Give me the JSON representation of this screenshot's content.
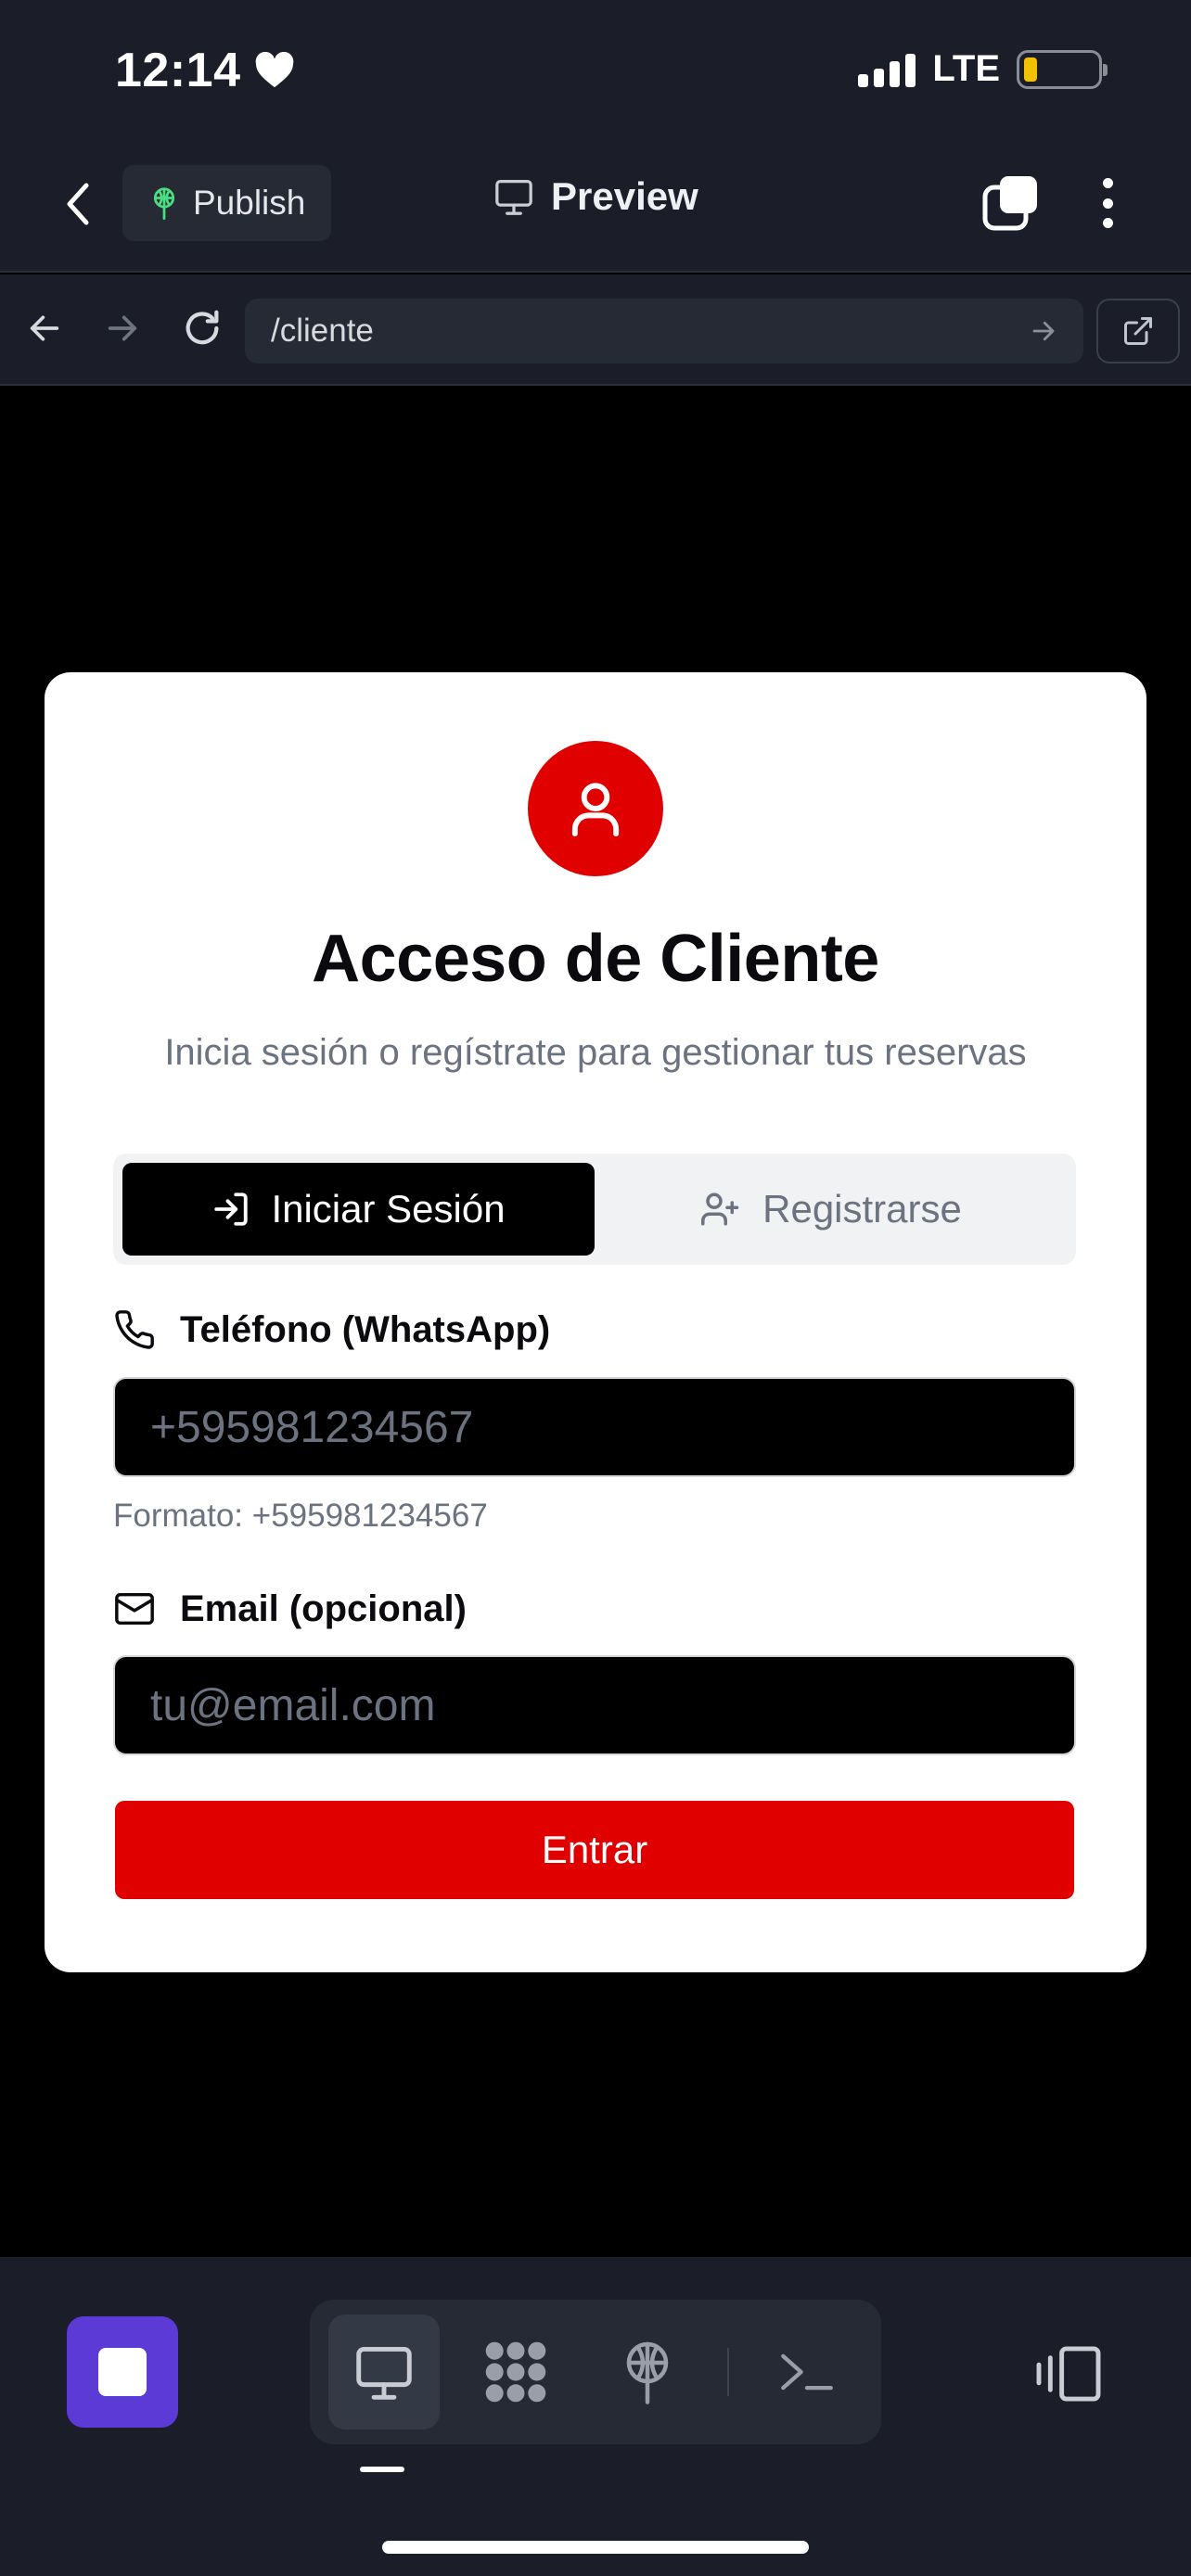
{
  "status_bar": {
    "time": "12:14",
    "network": "LTE",
    "icons": [
      "heart-icon",
      "signal-bars-icon",
      "battery-icon"
    ]
  },
  "toolbar": {
    "publish_label": "Publish",
    "preview_label": "Preview",
    "icons": [
      "chevron-left-icon",
      "antenna-icon",
      "monitor-icon",
      "tabs-icon",
      "more-vertical-icon"
    ]
  },
  "browser": {
    "url": "/cliente",
    "icons": [
      "arrow-left-icon",
      "arrow-right-icon",
      "reload-icon",
      "go-arrow-icon",
      "external-link-icon"
    ]
  },
  "login_card": {
    "title": "Acceso de Cliente",
    "subtitle": "Inicia sesión o regístrate para gestionar tus reservas",
    "tabs": [
      {
        "label": "Iniciar Sesión",
        "icon": "log-in-icon",
        "active": true
      },
      {
        "label": "Registrarse",
        "icon": "user-plus-icon",
        "active": false
      }
    ],
    "phone": {
      "label": "Teléfono (WhatsApp)",
      "placeholder": "+595981234567",
      "value": "",
      "hint": "Formato: +595981234567",
      "icon": "phone-icon"
    },
    "email": {
      "label": "Email (opcional)",
      "placeholder": "tu@email.com",
      "value": "",
      "icon": "mail-icon"
    },
    "submit_label": "Entrar"
  },
  "dock": {
    "items": [
      "monitor-icon",
      "grid-dots-icon",
      "antenna-icon",
      "terminal-icon"
    ],
    "active_item": "monitor-icon",
    "side_icons": [
      "stop-icon",
      "device-toggle-icon"
    ]
  },
  "colors": {
    "accent_red": "#e00000",
    "stop_purple": "#5b3ad6",
    "chrome_bg": "#1b1e28",
    "page_bg": "#000000",
    "card_bg": "#ffffff",
    "battery_low": "#f2c200"
  }
}
